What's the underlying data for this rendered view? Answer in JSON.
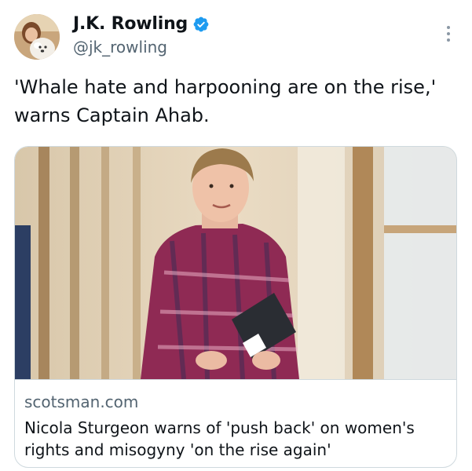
{
  "author": {
    "display_name": "J.K. Rowling",
    "handle": "@jk_rowling",
    "verified": true,
    "verified_color": "#1d9bf0"
  },
  "tweet": {
    "text_lines": [
      "'Whale hate and harpooning are on the rise,'",
      "warns Captain Ahab."
    ]
  },
  "link_card": {
    "domain": "scotsman.com",
    "title_lines": [
      "Nicola Sturgeon warns of 'push back' on women's",
      "rights and misogyny 'on the rise again'"
    ]
  },
  "icons": {
    "avatar": "profile-photo",
    "verified": "verified-badge-icon",
    "more": "more-options-icon"
  }
}
